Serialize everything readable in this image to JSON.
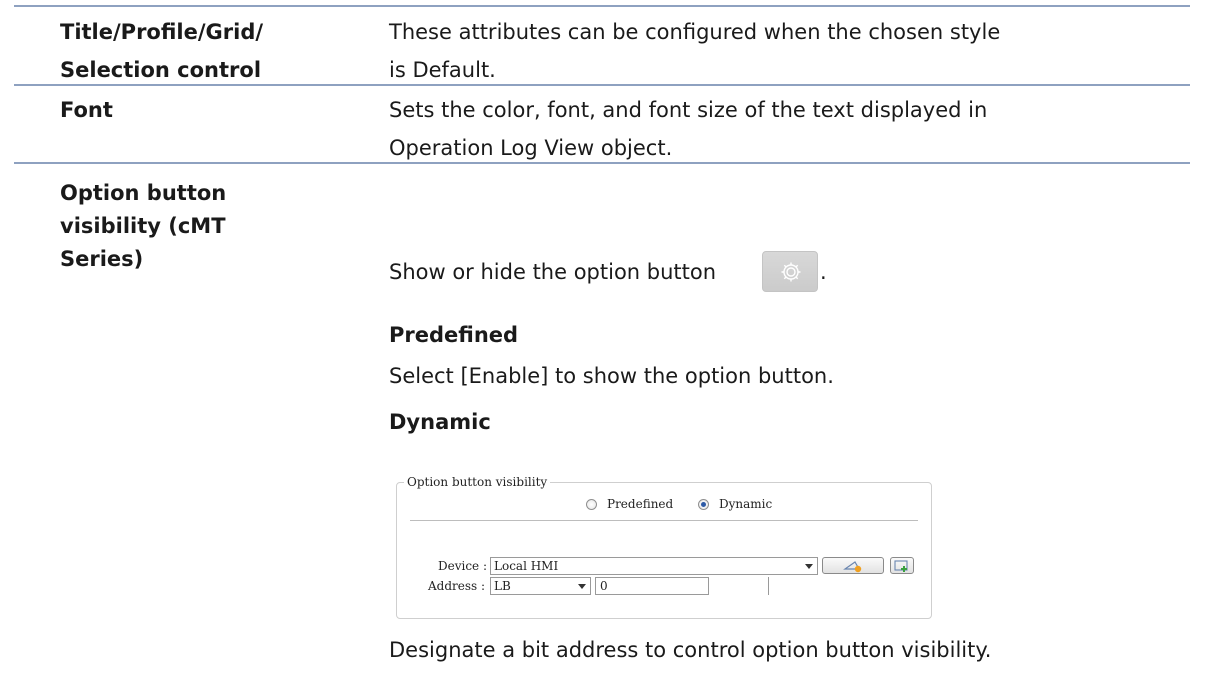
{
  "rows": [
    {
      "label_lines": [
        "Title/Profile/Grid/",
        "Selection control"
      ],
      "desc_lines": [
        "These attributes can be configured when the chosen style",
        "is Default."
      ]
    },
    {
      "label_lines": [
        "Font"
      ],
      "desc_lines": [
        "Sets the color, font, and font size of the text displayed in",
        "Operation Log View object."
      ]
    },
    {
      "label_lines": [
        "Option button",
        "visibility (cMT",
        "Series)"
      ],
      "desc_intro": "Show or hide the option button",
      "desc_intro_end": ".",
      "sub1_title": "Predefined",
      "sub1_text": "Select [Enable] to show the option button.",
      "sub2_title": "Dynamic",
      "footer": "Designate a bit address to control option button visibility."
    }
  ],
  "dialog": {
    "legend": "Option button visibility",
    "radio_predefined": "Predefined",
    "radio_dynamic": "Dynamic",
    "selected": "Dynamic",
    "device_label": "Device :",
    "device_value": "Local HMI",
    "address_label": "Address :",
    "address_type": "LB",
    "address_value": "0"
  },
  "icons": {
    "option_button": "gear-icon",
    "device_setting": "device-setting-icon",
    "device_add": "device-add-icon"
  },
  "colors": {
    "rule": "#8ea1c0",
    "radio_selected": "#2d5aa6"
  }
}
